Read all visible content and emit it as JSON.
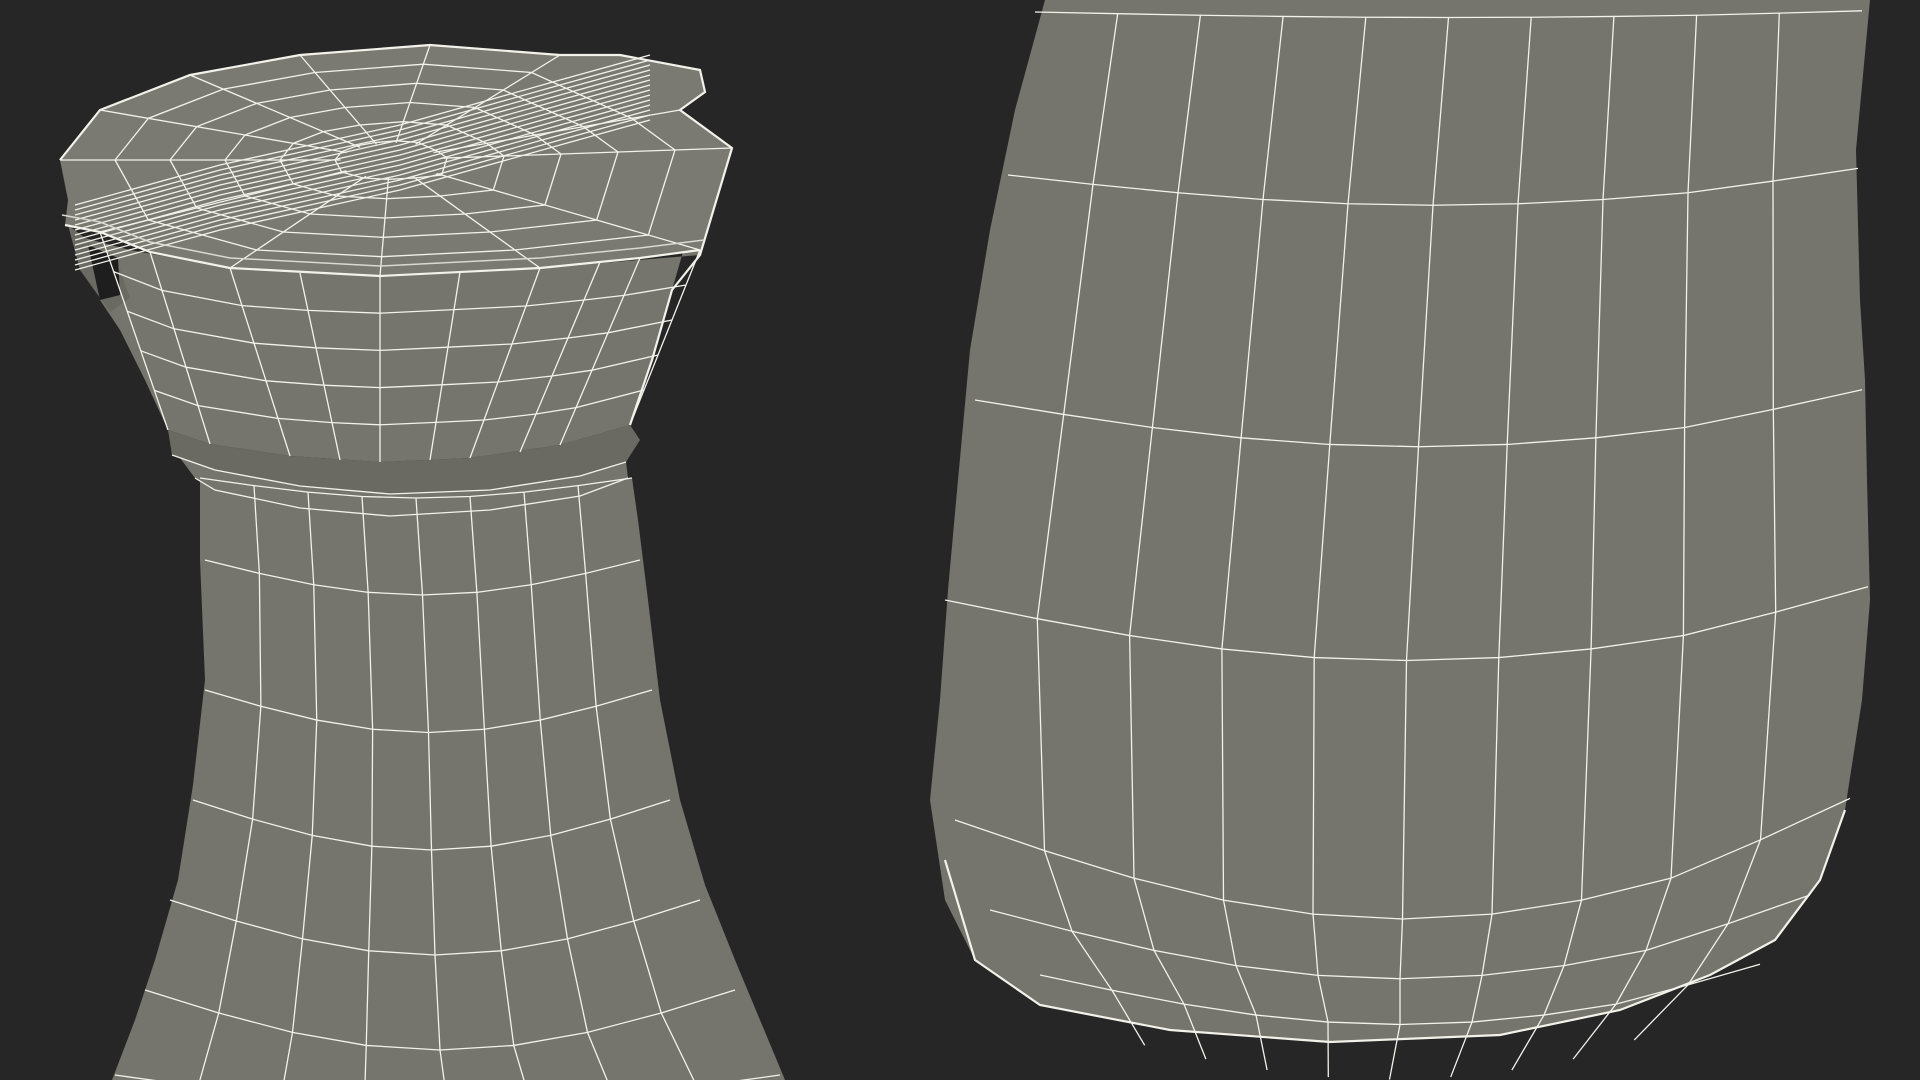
{
  "scene": {
    "description_free": true,
    "background": "#262626",
    "surface_fill": "#75756d",
    "surface_fill_dark": "#6a6a63",
    "wire_color": "#f2f2ea",
    "wire_soft": "#d9d9cf"
  },
  "views": [
    {
      "name": "bottle-neck-cap-view"
    },
    {
      "name": "bottle-base-body-view"
    }
  ]
}
